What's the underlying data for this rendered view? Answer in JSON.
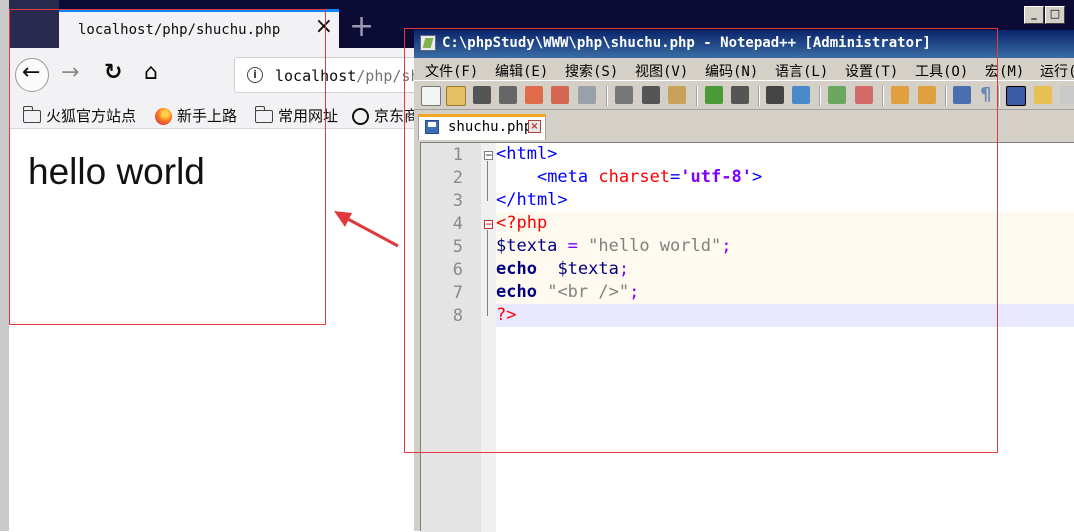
{
  "browser": {
    "tab_title": "localhost/php/shuchu.php",
    "tab_close": "×",
    "new_tab": "+",
    "nav": {
      "back": "←",
      "forward": "→",
      "reload": "↻",
      "home": "⌂"
    },
    "url_host": "localhost",
    "url_path": "/php/sh",
    "url_info": "i",
    "bookmarks": [
      {
        "label": "火狐官方站点",
        "icon": "folder-icon"
      },
      {
        "label": "新手上路",
        "icon": "firefox-icon"
      },
      {
        "label": "常用网址",
        "icon": "folder-icon"
      },
      {
        "label": "京东商",
        "icon": "globe-icon"
      }
    ],
    "page_text": "hello world"
  },
  "notepad": {
    "title": "C:\\phpStudy\\WWW\\php\\shuchu.php - Notepad++ [Administrator]",
    "menu": [
      "文件(F)",
      "编辑(E)",
      "搜索(S)",
      "视图(V)",
      "编码(N)",
      "语言(L)",
      "设置(T)",
      "工具(O)",
      "宏(M)",
      "运行("
    ],
    "tab_label": "shuchu.php",
    "tab_close": "×",
    "line_numbers": [
      "1",
      "2",
      "3",
      "4",
      "5",
      "6",
      "7",
      "8"
    ],
    "code": {
      "l1_tag": "<html>",
      "l2_indent": "    ",
      "l2_tag_open": "<meta",
      "l2_attr": "charset",
      "l2_eq": "=",
      "l2_val": "'utf-8'",
      "l2_tag_close": ">",
      "l3_tag": "</html>",
      "l4_open": "<?php",
      "l5_var": "$texta",
      "l5_eq": " = ",
      "l5_str": "\"hello world\"",
      "l5_semi": ";",
      "l6_kw": "echo",
      "l6_sp": "  ",
      "l6_var": "$texta",
      "l6_semi": ";",
      "l7_kw": "echo",
      "l7_sp": " ",
      "l7_str": "\"<br />\"",
      "l7_semi": ";",
      "l8_close": "?>"
    }
  },
  "colors": {
    "annotation": "#e0393e",
    "firefox_tabbar": "#0b0b36",
    "npp_titlebar": "#0a246a"
  }
}
